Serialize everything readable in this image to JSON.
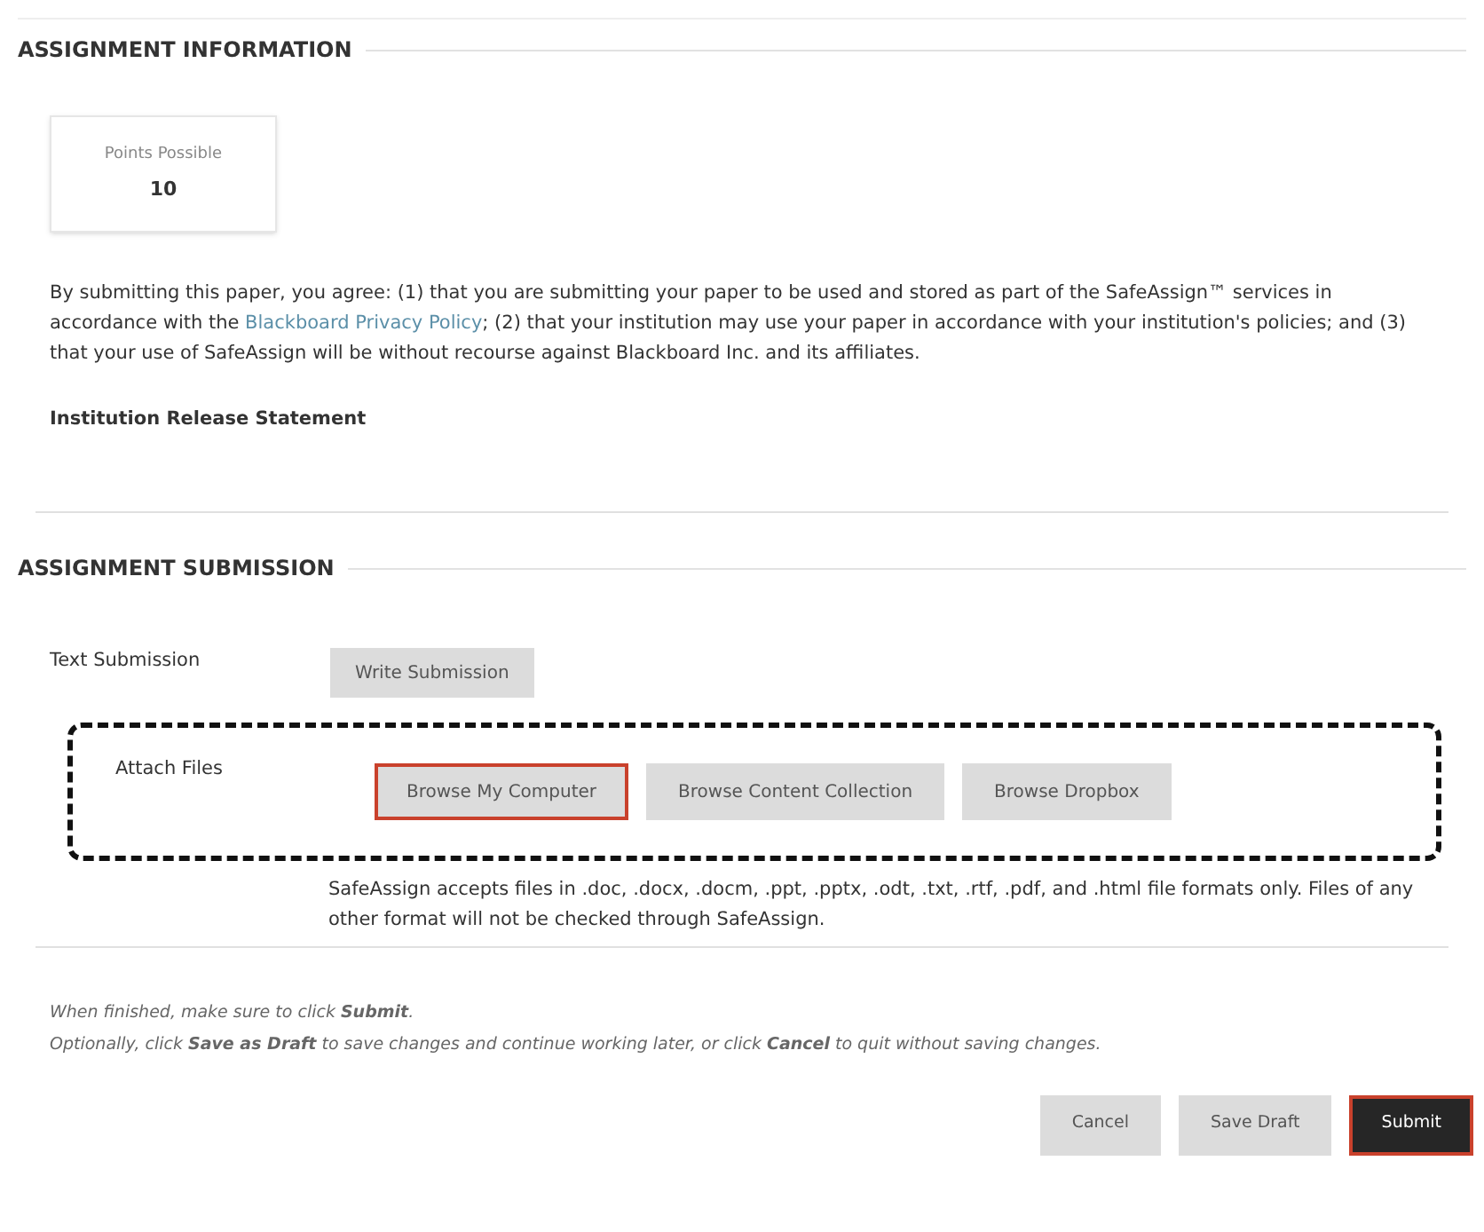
{
  "info_section": {
    "heading": "ASSIGNMENT INFORMATION",
    "points": {
      "label": "Points Possible",
      "value": "10"
    },
    "agreement": {
      "before": "By submitting this paper, you agree: (1) that you are submitting your paper to be used and stored as part of the SafeAssign™ services in accordance with the ",
      "link": "Blackboard Privacy Policy",
      "after": "; (2) that your institution may use your paper in accordance with your institution's policies; and (3) that your use of SafeAssign will be without recourse against Blackboard Inc. and its affiliates."
    },
    "release_statement": "Institution Release Statement"
  },
  "submission_section": {
    "heading": "ASSIGNMENT SUBMISSION",
    "text_submission": {
      "label": "Text Submission",
      "button": {
        "label": "Write Submission",
        "highlighted": false
      }
    },
    "attach_files": {
      "label": "Attach Files",
      "outlined": true,
      "buttons": [
        {
          "label": "Browse My Computer",
          "highlighted": true
        },
        {
          "label": "Browse Content Collection",
          "highlighted": false
        },
        {
          "label": "Browse Dropbox",
          "highlighted": false
        }
      ]
    },
    "formats_note": "SafeAssign accepts files in .doc, .docx, .docm, .ppt, .pptx, .odt, .txt, .rtf, .pdf, and .html file formats only. Files of any other format will not be checked through SafeAssign."
  },
  "instructions": [
    "When finished, make sure to click **Submit**.",
    "Optionally, click **Save as Draft** to save changes and continue working later, or click **Cancel** to quit without saving changes."
  ],
  "footer_buttons": [
    {
      "label": "Cancel",
      "kind": "secondary",
      "highlighted": false
    },
    {
      "label": "Save Draft",
      "kind": "secondary",
      "highlighted": false
    },
    {
      "label": "Submit",
      "kind": "primary",
      "highlighted": true
    }
  ]
}
